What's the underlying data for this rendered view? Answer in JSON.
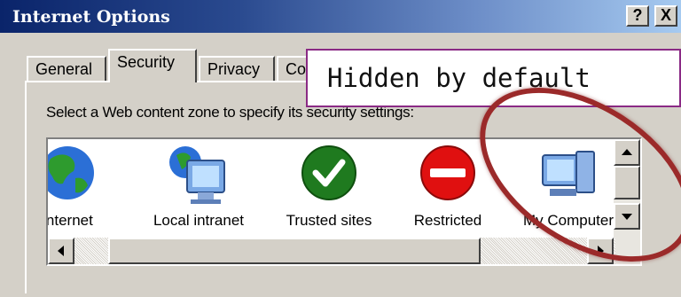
{
  "window": {
    "title": "Internet Options",
    "help_btn": "?",
    "close_btn": "X"
  },
  "tabs": [
    {
      "label": "General",
      "active": false
    },
    {
      "label": "Security",
      "active": true
    },
    {
      "label": "Privacy",
      "active": false
    },
    {
      "label": "Cor",
      "active": false
    }
  ],
  "security": {
    "prompt": "Select a Web content zone to specify its security settings:",
    "zones": [
      {
        "label": "Internet",
        "icon": "globe-icon"
      },
      {
        "label": "Local intranet",
        "icon": "intranet-icon"
      },
      {
        "label": "Trusted sites",
        "icon": "checkmark-icon"
      },
      {
        "label": "Restricted",
        "icon": "no-entry-icon"
      },
      {
        "label": "My Computer",
        "icon": "computer-icon"
      }
    ]
  },
  "annotation": {
    "callout": "Hidden by default",
    "color": "#9b2a2a"
  }
}
